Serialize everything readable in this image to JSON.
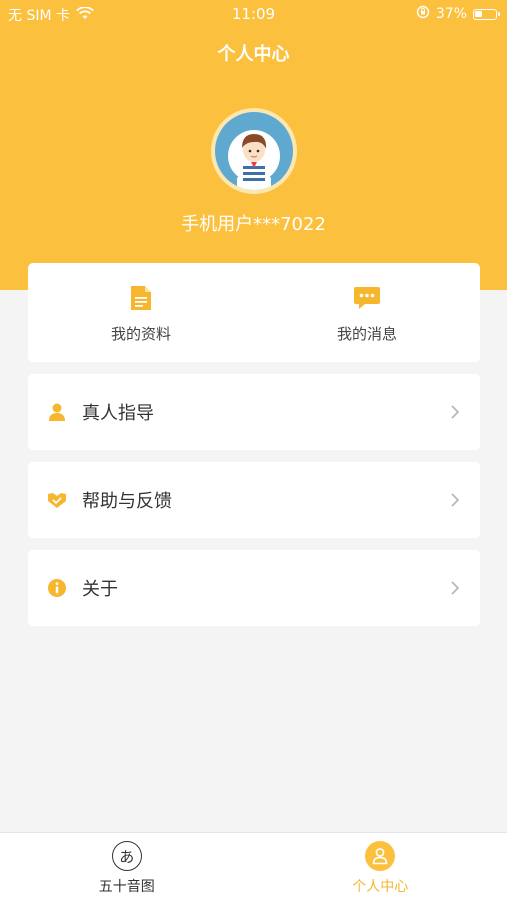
{
  "status_bar": {
    "carrier": "无 SIM 卡",
    "time": "11:09",
    "battery": "37%",
    "battery_level": 0.37,
    "wifi_icon": "wifi-icon",
    "lock_icon": "orientation-lock-icon"
  },
  "header": {
    "title": "个人中心",
    "username": "手机用户***7022"
  },
  "quick_actions": [
    {
      "label": "我的资料",
      "icon": "document-icon"
    },
    {
      "label": "我的消息",
      "icon": "chat-bubble-icon"
    }
  ],
  "menu": [
    {
      "label": "真人指导",
      "icon": "person-icon"
    },
    {
      "label": "帮助与反馈",
      "icon": "handshake-icon"
    },
    {
      "label": "关于",
      "icon": "info-icon"
    }
  ],
  "tabbar": {
    "tabs": [
      {
        "label": "五十音图",
        "icon_glyph": "あ",
        "active": false
      },
      {
        "label": "个人中心",
        "icon": "user-icon",
        "active": true
      }
    ]
  },
  "colors": {
    "accent": "#fbc03d",
    "background": "#f4f4f4",
    "icon": "#f6b72f"
  }
}
